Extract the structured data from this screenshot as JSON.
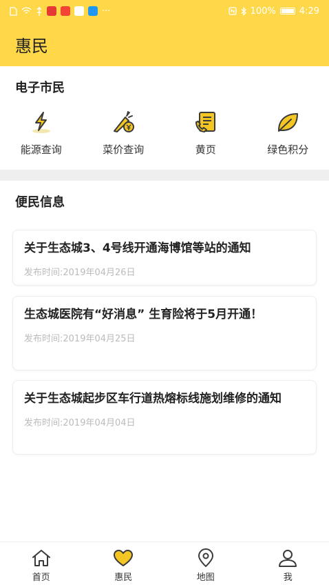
{
  "status_bar": {
    "left_icons": [
      "sim-icon",
      "wifi-icon",
      "usb-icon",
      "mail-app-icon",
      "scissors-app-icon",
      "map-app-icon",
      "send-app-icon"
    ],
    "more": "···",
    "battery": "100%",
    "time": "4:29"
  },
  "header": {
    "title": "惠民"
  },
  "section1": {
    "title": "电子市民"
  },
  "services": [
    {
      "label": "能源查询",
      "icon": "lightning-icon"
    },
    {
      "label": "菜价查询",
      "icon": "carrot-price-icon"
    },
    {
      "label": "黄页",
      "icon": "phone-book-icon"
    },
    {
      "label": "绿色积分",
      "icon": "leaf-icon"
    }
  ],
  "section2": {
    "title": "便民信息"
  },
  "news": [
    {
      "title": "关于生态城3、4号线开通海博馆等站的通知",
      "date": "发布时间:2019年04月26日"
    },
    {
      "title": "生态城医院有“好消息” 生育险将于5月开通！",
      "date": "发布时间:2019年04月25日"
    },
    {
      "title": "关于生态城起步区车行道热熔标线施划维修的通知",
      "date": "发布时间:2019年04月04日"
    }
  ],
  "tabs": [
    {
      "label": "首页",
      "icon": "home-icon"
    },
    {
      "label": "惠民",
      "icon": "heart-icon"
    },
    {
      "label": "地图",
      "icon": "location-icon"
    },
    {
      "label": "我",
      "icon": "user-icon"
    }
  ],
  "colors": {
    "accent": "#ffd84a",
    "icon_fill": "#f3c623",
    "icon_stroke": "#3a3a3a"
  }
}
